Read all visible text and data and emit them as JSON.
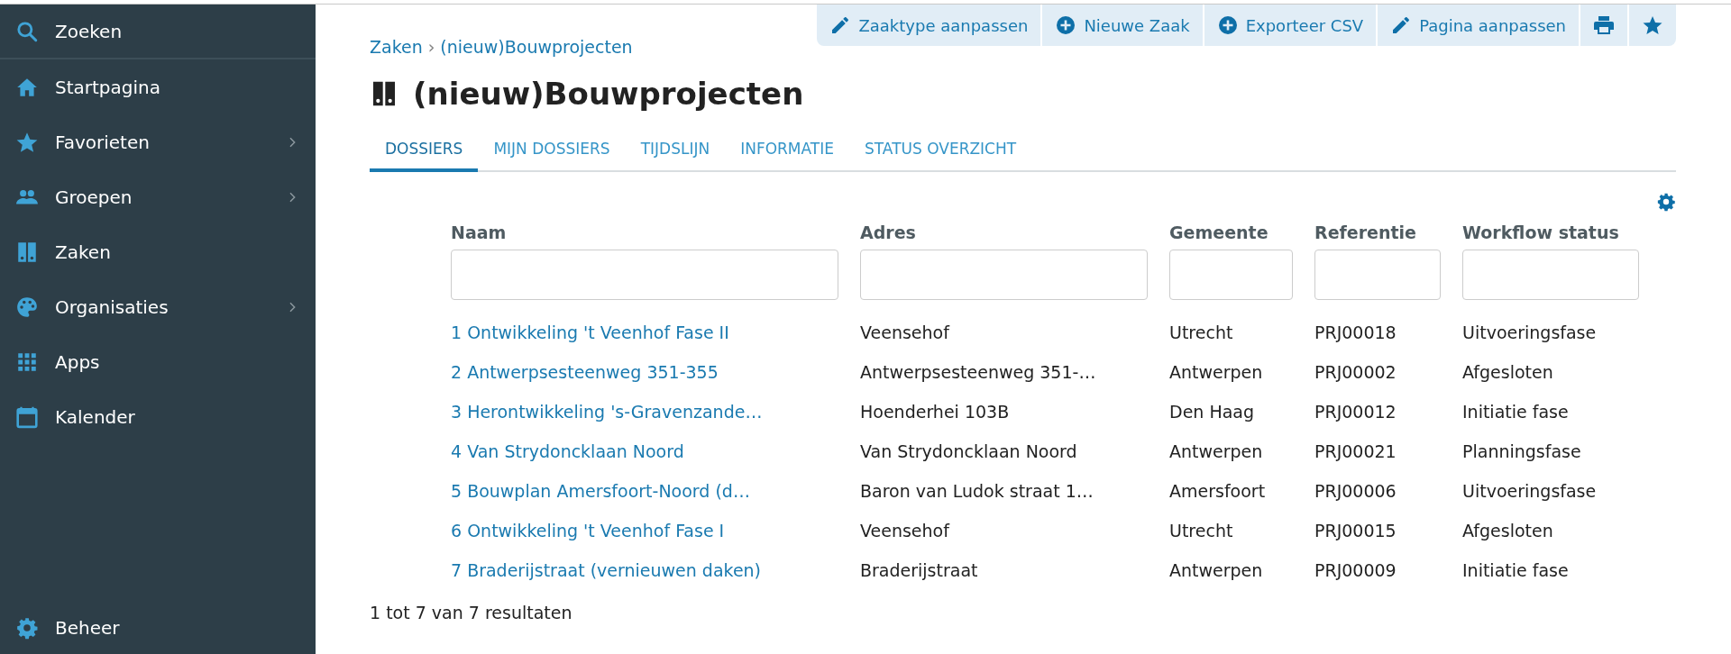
{
  "sidebar": {
    "search": {
      "label": "Zoeken"
    },
    "items": [
      {
        "label": "Startpagina",
        "expandable": false
      },
      {
        "label": "Favorieten",
        "expandable": true
      },
      {
        "label": "Groepen",
        "expandable": true
      },
      {
        "label": "Zaken",
        "expandable": false
      },
      {
        "label": "Organisaties",
        "expandable": true
      },
      {
        "label": "Apps",
        "expandable": false
      },
      {
        "label": "Kalender",
        "expandable": false
      }
    ],
    "footer": {
      "label": "Beheer"
    }
  },
  "toolbar": [
    {
      "kind": "edit",
      "label": "Zaaktype aanpassen"
    },
    {
      "kind": "add",
      "label": "Nieuwe Zaak"
    },
    {
      "kind": "add",
      "label": "Exporteer CSV"
    },
    {
      "kind": "edit",
      "label": "Pagina aanpassen"
    },
    {
      "kind": "print"
    },
    {
      "kind": "favorite"
    }
  ],
  "breadcrumb": [
    "Zaken",
    "(nieuw)Bouwprojecten"
  ],
  "breadcrumb_separator": "›",
  "title": "(nieuw)Bouwprojecten",
  "tabs": [
    {
      "label": "DOSSIERS",
      "selected": true
    },
    {
      "label": "MIJN DOSSIERS",
      "selected": false
    },
    {
      "label": "TIJDSLIJN",
      "selected": false
    },
    {
      "label": "INFORMATIE",
      "selected": false
    },
    {
      "label": "STATUS OVERZICHT",
      "selected": false
    }
  ],
  "table": {
    "columns": [
      "Naam",
      "Adres",
      "Gemeente",
      "Referentie",
      "Workflow status"
    ],
    "rows": [
      [
        "1 Ontwikkeling 't Veenhof Fase II",
        "Veensehof",
        "Utrecht",
        "PRJ00018",
        "Uitvoeringsfase"
      ],
      [
        "2 Antwerpsesteenweg 351-355",
        "Antwerpsesteenweg 351-…",
        "Antwerpen",
        "PRJ00002",
        "Afgesloten"
      ],
      [
        "3 Herontwikkeling 's-Gravenzande…",
        "Hoenderhei 103B",
        "Den Haag",
        "PRJ00012",
        "Initiatie fase"
      ],
      [
        "4 Van Strydoncklaan Noord",
        "Van Strydoncklaan Noord",
        "Antwerpen",
        "PRJ00021",
        "Planningsfase"
      ],
      [
        "5 Bouwplan Amersfoort-Noord (d…",
        "Baron van Ludok straat 1…",
        "Amersfoort",
        "PRJ00006",
        "Uitvoeringsfase"
      ],
      [
        "6 Ontwikkeling 't Veenhof Fase I",
        "Veensehof",
        "Utrecht",
        "PRJ00015",
        "Afgesloten"
      ],
      [
        "7 Braderijstraat (vernieuwen daken)",
        "Braderijstraat",
        "Antwerpen",
        "PRJ00009",
        "Initiatie fase"
      ]
    ]
  },
  "result_count": "1 tot 7 van 7 resultaten"
}
